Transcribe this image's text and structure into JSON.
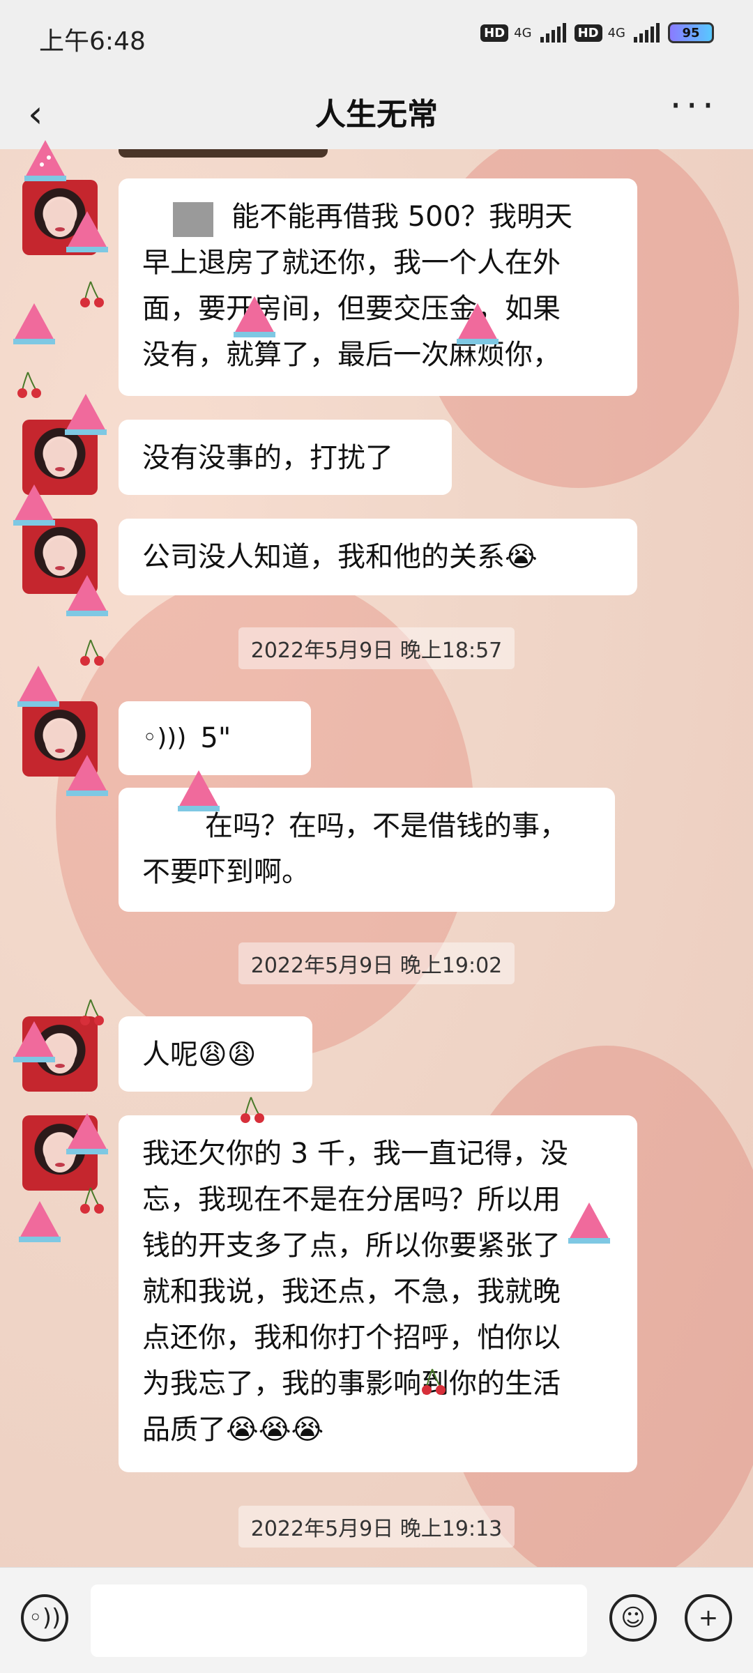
{
  "status": {
    "time": "上午6:48",
    "hd1": "HD",
    "net1": "4G",
    "hd2": "HD",
    "net2": "4G",
    "battery": "95"
  },
  "header": {
    "title": "人生无常"
  },
  "messages": [
    {
      "lines": [
        "能不能再借我 500？我明天",
        "早上退房了就还你，我一个人在外",
        "面，要开房间，但要交压金，如果",
        "没有，就算了，最后一次麻烦你，"
      ]
    },
    {
      "lines": [
        "没有没事的，打扰了"
      ]
    },
    {
      "lines": [
        "公司没人知道，我和他的关系😭"
      ]
    },
    {
      "timestamp": "2022年5月9日 晚上18:57"
    },
    {
      "voice_duration": "5\""
    },
    {
      "lines": [
        "在吗？在吗，不是借钱的事，",
        "不要吓到啊。"
      ]
    },
    {
      "timestamp": "2022年5月9日 晚上19:02"
    },
    {
      "lines": [
        "人呢😩😩"
      ]
    },
    {
      "lines": [
        "我还欠你的 3 千，我一直记得，没",
        "忘，我现在不是在分居吗？所以用",
        "钱的开支多了点，所以你要紧张了",
        "就和我说，我还点，不急，我就晚",
        "点还你，我和你打个招呼，怕你以",
        "为我忘了，我的事影响到你的生活",
        "品质了😭😭😭"
      ]
    },
    {
      "timestamp": "2022年5月9日 晚上19:13"
    }
  ],
  "colors": {
    "bubble": "#ffffff",
    "bar": "#efefef",
    "accent_wm": "#f06a9c",
    "cherry": "#d72f3a"
  }
}
